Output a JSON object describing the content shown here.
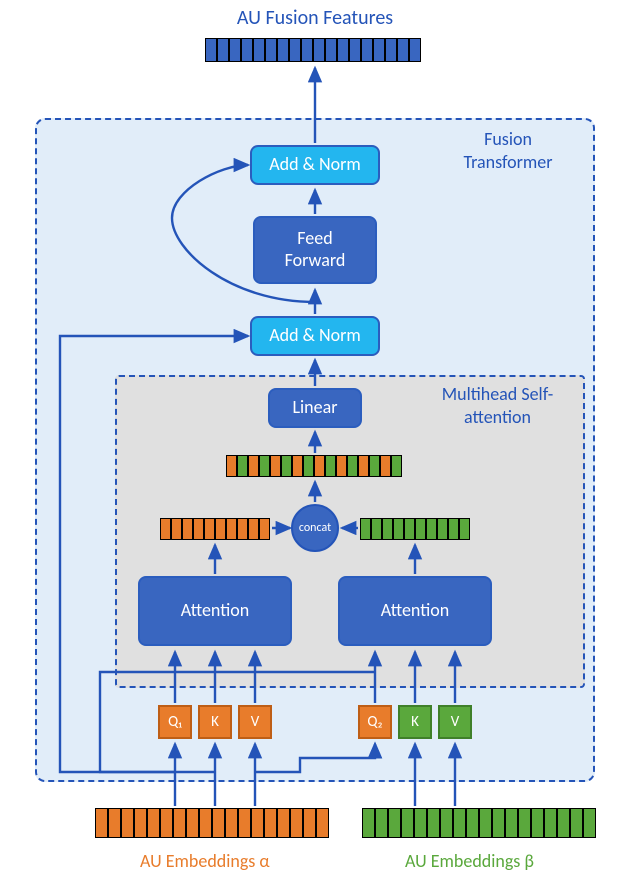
{
  "title": "AU Fusion Features",
  "outer_box_label": "Fusion Transformer",
  "inner_box_label": "Multihead Self-attention",
  "blocks": {
    "add_norm_top": "Add & Norm",
    "feed_forward": "Feed\nForward",
    "add_norm_bot": "Add & Norm",
    "linear": "Linear",
    "concat": "concat",
    "attention_left": "Attention",
    "attention_right": "Attention"
  },
  "qkv_left": {
    "q": "Q₁",
    "k": "K",
    "v": "V"
  },
  "qkv_right": {
    "q": "Q₂",
    "k": "K",
    "v": "V"
  },
  "input_label_a": "AU Embeddings α",
  "input_label_b": "AU Embeddings β",
  "colors": {
    "blue": "#3966c0",
    "lightblue": "#23b6ef",
    "orange": "#e87c2b",
    "green": "#5aa83c",
    "outline_blue": "#2454b8"
  }
}
